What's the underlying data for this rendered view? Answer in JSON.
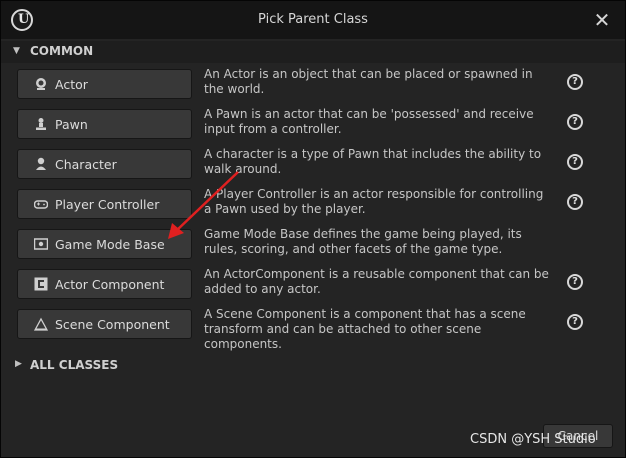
{
  "window": {
    "title": "Pick Parent Class",
    "logo_text": "U",
    "close_glyph": "✕"
  },
  "sections": {
    "common": {
      "label": "COMMON",
      "arrow": "▼"
    },
    "all_classes": {
      "label": "ALL CLASSES",
      "arrow": "▶"
    }
  },
  "classes": [
    {
      "label": "Actor",
      "icon": "actor-icon",
      "description": "An Actor is an object that can be placed or spawned in the world."
    },
    {
      "label": "Pawn",
      "icon": "pawn-icon",
      "description": "A Pawn is an actor that can be 'possessed' and receive input from a controller."
    },
    {
      "label": "Character",
      "icon": "character-icon",
      "description": "A character is a type of Pawn that includes the ability to walk around."
    },
    {
      "label": "Player Controller",
      "icon": "gamepad-icon",
      "description": "A Player Controller is an actor responsible for controlling a Pawn used by the player."
    },
    {
      "label": "Game Mode Base",
      "icon": "game-mode-icon",
      "description": "Game Mode Base defines the game being played, its rules, scoring, and other facets of the game type."
    },
    {
      "label": "Actor Component",
      "icon": "actor-component-icon",
      "description": "An ActorComponent is a reusable component that can be added to any actor."
    },
    {
      "label": "Scene Component",
      "icon": "scene-component-icon",
      "description": "A Scene Component is a component that has a scene transform and can be attached to other scene components."
    }
  ],
  "help_glyph": "?",
  "cancel_label": "Cancel",
  "watermark": "CSDN @YSH Studio",
  "annotation_arrow_color": "#e02020"
}
